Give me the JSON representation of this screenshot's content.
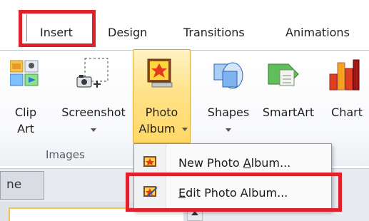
{
  "tabs": [
    {
      "label": "Insert",
      "active": true
    },
    {
      "label": "Design"
    },
    {
      "label": "Transitions"
    },
    {
      "label": "Animations"
    }
  ],
  "ribbon": {
    "buttons": {
      "clip_art": {
        "line1": "Clip",
        "line2": "Art"
      },
      "screenshot": {
        "line1": "Screenshot",
        "has_dropdown": true
      },
      "photo_album": {
        "line1": "Photo",
        "line2": "Album",
        "has_dropdown": true,
        "pressed": true
      },
      "shapes": {
        "line1": "Shapes",
        "has_dropdown": true
      },
      "smartart": {
        "line1": "SmartArt"
      },
      "chart": {
        "line1": "Chart"
      }
    },
    "group_label": "Images"
  },
  "pane_tab": {
    "label": "ne"
  },
  "menu": {
    "items": [
      {
        "before": "New Photo ",
        "accel": "A",
        "after": "lbum...",
        "icon": "new-photo-album-icon"
      },
      {
        "before": "",
        "accel": "E",
        "after": "dit Photo Album...",
        "icon": "edit-photo-album-icon"
      }
    ]
  },
  "colors": {
    "highlight": "#e0202a",
    "pressed_button": "#ffe28a"
  }
}
